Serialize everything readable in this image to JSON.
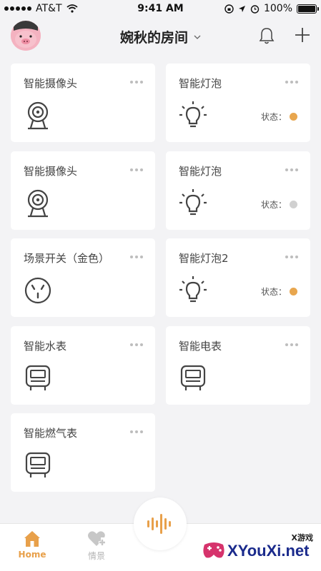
{
  "status_bar": {
    "carrier": "AT&T",
    "time": "9:41 AM",
    "battery": "100%",
    "battery_level": 1.0
  },
  "header": {
    "room_title": "婉秋的房间"
  },
  "colors": {
    "accent": "#e8a04a",
    "status_on": "#e8a64e",
    "status_off": "#d0d0d0",
    "inactive_tab": "#c7c7c7"
  },
  "devices": [
    {
      "name": "智能摄像头",
      "icon": "camera-icon"
    },
    {
      "name": "智能灯泡",
      "icon": "bulb-icon",
      "status_label": "状态：",
      "status": "on"
    },
    {
      "name": "智能摄像头",
      "icon": "camera-icon"
    },
    {
      "name": "智能灯泡",
      "icon": "bulb-icon",
      "status_label": "状态：",
      "status": "off"
    },
    {
      "name": "场景开关（金色）",
      "icon": "socket-icon"
    },
    {
      "name": "智能灯泡2",
      "icon": "bulb-icon",
      "status_label": "状态：",
      "status": "on"
    },
    {
      "name": "智能水表",
      "icon": "meter-icon"
    },
    {
      "name": "智能电表",
      "icon": "meter-icon"
    },
    {
      "name": "智能燃气表",
      "icon": "meter-icon"
    }
  ],
  "tabbar": {
    "home": "Home",
    "scene": "情景"
  },
  "watermark": {
    "top": "X游戏",
    "text": "XYouXi.net"
  }
}
